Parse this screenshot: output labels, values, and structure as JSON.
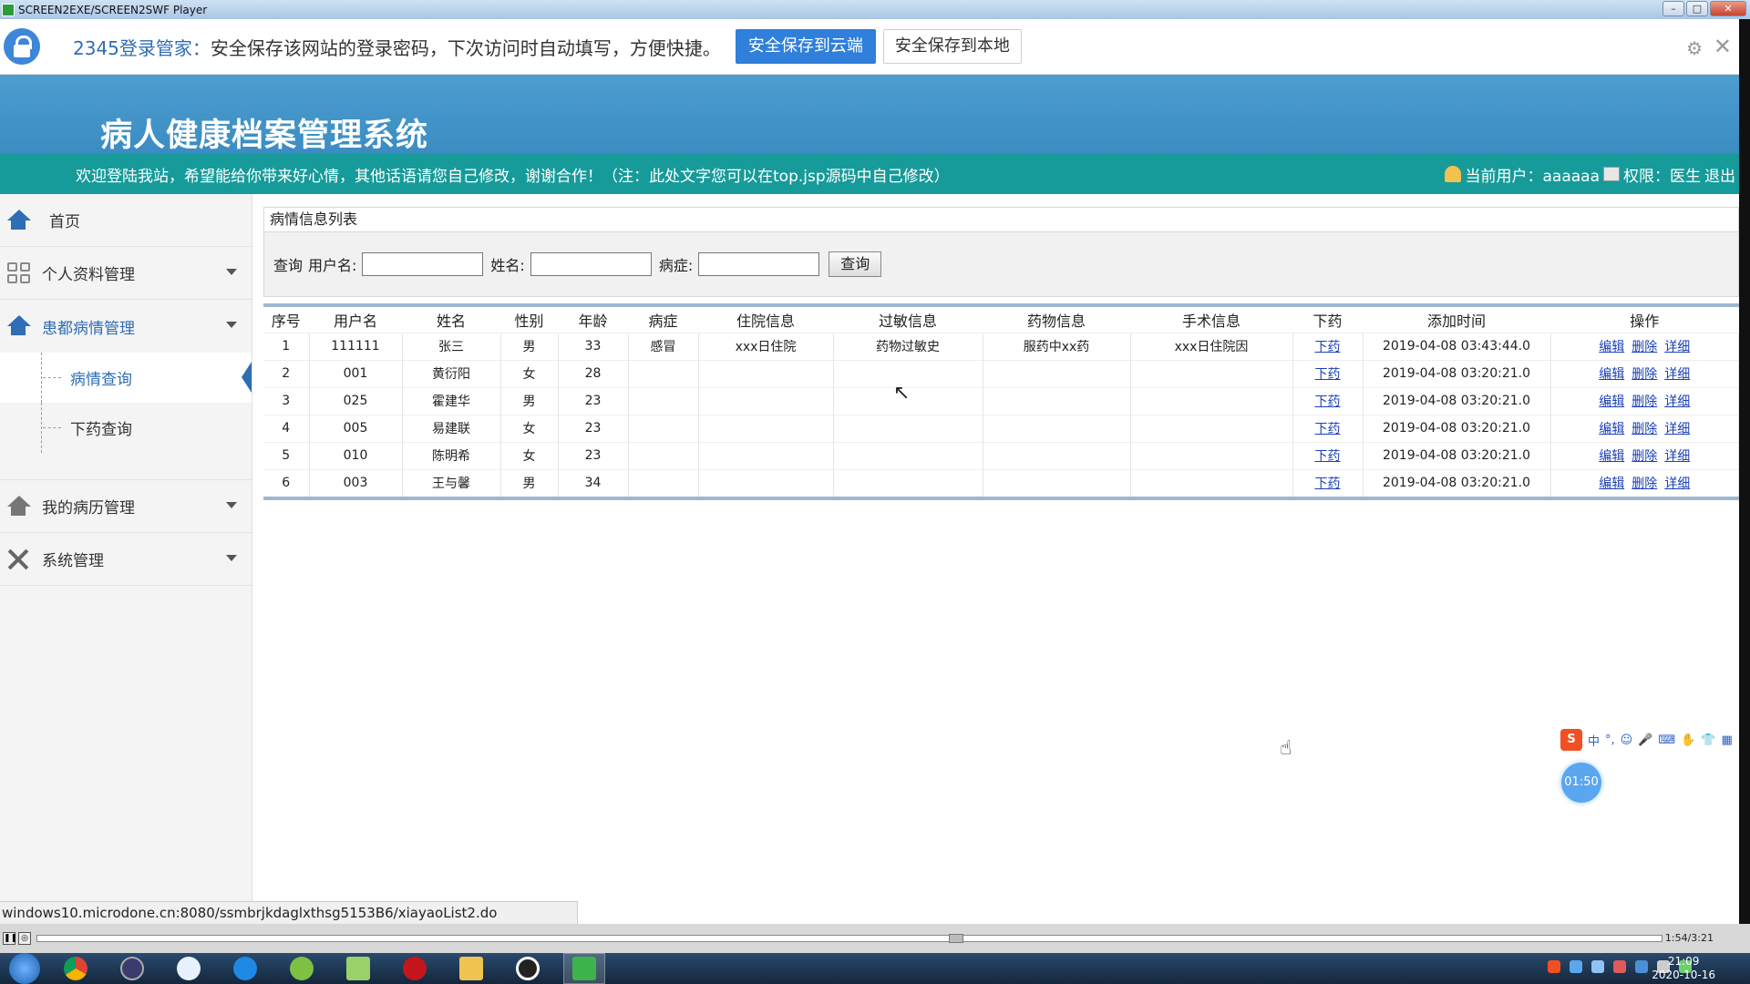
{
  "window": {
    "title": "SCREEN2EXE/SCREEN2SWF Player",
    "controls": {
      "minimize": "–",
      "maximize": "□",
      "close": "✕"
    }
  },
  "password_bar": {
    "brand": "2345登录管家：",
    "message": "安全保存该网站的登录密码，下次访问时自动填写，方便快捷。",
    "save_cloud": "安全保存到云端",
    "save_local": "安全保存到本地",
    "settings_icon": "gear-icon",
    "close_icon": "close-icon"
  },
  "header": {
    "title": "病人健康档案管理系统",
    "welcome": "欢迎登陆我站，希望能给你带来好心情，其他话语请您自己修改，谢谢合作！（注：此处文字您可以在top.jsp源码中自己修改）",
    "current_user_label": "当前用户：aaaaaa",
    "permission_label": "权限：医生",
    "logout": "退出"
  },
  "sidebar": {
    "home": "首页",
    "personal": "个人资料管理",
    "patient_mgmt": "患都病情管理",
    "sub_items": [
      "病情查询",
      "下药查询"
    ],
    "records": "我的病历管理",
    "system": "系统管理",
    "colors": {
      "active": "#2f6db5"
    }
  },
  "content": {
    "panel_title": "病情信息列表",
    "search": {
      "prefix": "查询",
      "username_label": "用户名:",
      "name_label": "姓名:",
      "disease_label": "病症:",
      "username_value": "",
      "name_value": "",
      "disease_value": "",
      "button": "查询"
    },
    "table": {
      "headers": [
        "序号",
        "用户名",
        "姓名",
        "性别",
        "年龄",
        "病症",
        "住院信息",
        "过敏信息",
        "药物信息",
        "手术信息",
        "下药",
        "添加时间",
        "操作"
      ],
      "rows": [
        {
          "no": "1",
          "username": "111111",
          "name": "张三",
          "gender": "男",
          "age": "33",
          "disease": "感冒",
          "hospital": "xxx日住院",
          "allergy": "药物过敏史",
          "drug": "服药中xx药",
          "surgery": "xxx日住院因",
          "prescribe": "下药",
          "time": "2019-04-08 03:43:44.0",
          "edit": "编辑",
          "delete": "删除",
          "detail": "详细"
        },
        {
          "no": "2",
          "username": "001",
          "name": "黄衍阳",
          "gender": "女",
          "age": "28",
          "disease": "",
          "hospital": "",
          "allergy": "",
          "drug": "",
          "surgery": "",
          "prescribe": "下药",
          "time": "2019-04-08 03:20:21.0",
          "edit": "编辑",
          "delete": "删除",
          "detail": "详细"
        },
        {
          "no": "3",
          "username": "025",
          "name": "霍建华",
          "gender": "男",
          "age": "23",
          "disease": "",
          "hospital": "",
          "allergy": "",
          "drug": "",
          "surgery": "",
          "prescribe": "下药",
          "time": "2019-04-08 03:20:21.0",
          "edit": "编辑",
          "delete": "删除",
          "detail": "详细"
        },
        {
          "no": "4",
          "username": "005",
          "name": "易建联",
          "gender": "女",
          "age": "23",
          "disease": "",
          "hospital": "",
          "allergy": "",
          "drug": "",
          "surgery": "",
          "prescribe": "下药",
          "time": "2019-04-08 03:20:21.0",
          "edit": "编辑",
          "delete": "删除",
          "detail": "详细"
        },
        {
          "no": "5",
          "username": "010",
          "name": "陈明希",
          "gender": "女",
          "age": "23",
          "disease": "",
          "hospital": "",
          "allergy": "",
          "drug": "",
          "surgery": "",
          "prescribe": "下药",
          "time": "2019-04-08 03:20:21.0",
          "edit": "编辑",
          "delete": "删除",
          "detail": "详细"
        },
        {
          "no": "6",
          "username": "003",
          "name": "王与馨",
          "gender": "男",
          "age": "34",
          "disease": "",
          "hospital": "",
          "allergy": "",
          "drug": "",
          "surgery": "",
          "prescribe": "下药",
          "time": "2019-04-08 03:20:21.0",
          "edit": "编辑",
          "delete": "删除",
          "detail": "详细"
        }
      ]
    }
  },
  "status_url": "windows10.microdone.cn:8080/ssmbrjkdaglxthsg5153B6/xiayaoList2.do",
  "ime": {
    "logo": "S",
    "items": [
      "中",
      "°,",
      "☺",
      "🎤",
      "⌨",
      "✋",
      "👕",
      "▦"
    ],
    "timer": "01:50"
  },
  "player": {
    "time": "1:54/3:21"
  },
  "taskbar": {
    "clock_time": "21:09",
    "clock_date": "2020-10-16"
  }
}
